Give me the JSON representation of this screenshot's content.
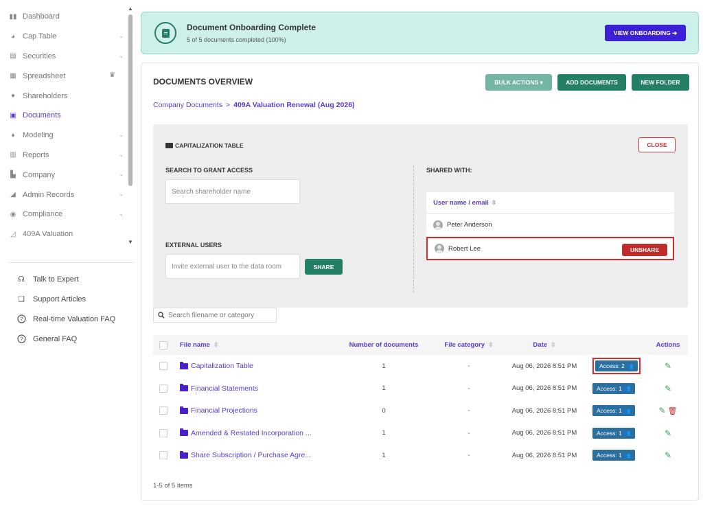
{
  "sidebar": {
    "nav": [
      {
        "label": "Dashboard",
        "icon": "dashboard-icon",
        "glyph": "▮▮",
        "chevron": false
      },
      {
        "label": "Cap Table",
        "icon": "cap-table-icon",
        "glyph": "◕",
        "chevron": true
      },
      {
        "label": "Securities",
        "icon": "securities-icon",
        "glyph": "▤",
        "chevron": true
      },
      {
        "label": "Spreadsheet",
        "icon": "spreadsheet-icon",
        "glyph": "▦",
        "chevron": false,
        "crown": true
      },
      {
        "label": "Shareholders",
        "icon": "shareholders-icon",
        "glyph": "●",
        "chevron": false
      },
      {
        "label": "Documents",
        "icon": "documents-icon",
        "glyph": "▣",
        "chevron": false,
        "active": true
      },
      {
        "label": "Modeling",
        "icon": "modeling-icon",
        "glyph": "♦",
        "chevron": true
      },
      {
        "label": "Reports",
        "icon": "reports-icon",
        "glyph": "▥",
        "chevron": true
      },
      {
        "label": "Company",
        "icon": "company-icon",
        "glyph": "▙",
        "chevron": true
      },
      {
        "label": "Admin Records",
        "icon": "admin-records-icon",
        "glyph": "◢",
        "chevron": true
      },
      {
        "label": "Compliance",
        "icon": "compliance-icon",
        "glyph": "◉",
        "chevron": true
      },
      {
        "label": "409A Valuation",
        "icon": "valuation-icon",
        "glyph": "◿",
        "chevron": false
      }
    ],
    "help": [
      {
        "label": "Talk to Expert",
        "icon": "headset-icon",
        "glyph": "☊"
      },
      {
        "label": "Support Articles",
        "icon": "book-icon",
        "glyph": "❑"
      },
      {
        "label": "Real-time Valuation FAQ",
        "icon": "question-icon",
        "glyph": "?"
      },
      {
        "label": "General FAQ",
        "icon": "question-icon",
        "glyph": "?"
      }
    ]
  },
  "banner": {
    "title": "Document Onboarding Complete",
    "subtitle": "5 of 5 documents completed (100%)",
    "button": "VIEW ONBOARDING ➔"
  },
  "overview": {
    "title": "DOCUMENTS OVERVIEW",
    "bulk_actions": "BULK ACTIONS ▾",
    "add_documents": "ADD DOCUMENTS",
    "new_folder": "NEW FOLDER",
    "breadcrumb_root": "Company Documents",
    "breadcrumb_sep": ">",
    "breadcrumb_current": "409A Valuation Renewal (Aug 2026)"
  },
  "panel": {
    "title": "CAPITALIZATION TABLE",
    "close": "CLOSE",
    "grant_label": "SEARCH TO GRANT ACCESS",
    "grant_placeholder": "Search shareholder name",
    "external_label": "EXTERNAL USERS",
    "external_placeholder": "Invite external user to the data room",
    "share": "SHARE",
    "shared_with_label": "SHARED WITH:",
    "shared_header": "User name / email",
    "shared_users": [
      {
        "name": "Peter Anderson"
      },
      {
        "name": "Robert Lee",
        "unshare": "UNSHARE"
      }
    ]
  },
  "files": {
    "search_placeholder": "Search filename or category",
    "headers": {
      "name": "File name",
      "count": "Number of documents",
      "category": "File category",
      "date": "Date",
      "actions": "Actions"
    },
    "rows": [
      {
        "name": "Capitalization Table",
        "count": "1",
        "category": "-",
        "date": "Aug 06, 2026 8:51 PM",
        "access": "Access: 2",
        "delete": false
      },
      {
        "name": "Financial Statements",
        "count": "1",
        "category": "-",
        "date": "Aug 06, 2026 8:51 PM",
        "access": "Access: 1",
        "delete": false
      },
      {
        "name": "Financial Projections",
        "count": "0",
        "category": "-",
        "date": "Aug 06, 2026 8:51 PM",
        "access": "Access: 1",
        "delete": true
      },
      {
        "name": "Amended & Restated Incorporation ...",
        "count": "1",
        "category": "-",
        "date": "Aug 06, 2026 8:51 PM",
        "access": "Access: 1",
        "delete": false
      },
      {
        "name": "Share Subscription / Purchase Agre...",
        "count": "1",
        "category": "-",
        "date": "Aug 06, 2026 8:51 PM",
        "access": "Access: 1",
        "delete": false
      }
    ],
    "pagination": "1-5 of 5 items"
  },
  "colors": {
    "accent": "#5a3ad3",
    "primary_button": "#238066",
    "danger": "#c02b2b",
    "banner_bg": "#cdf1ea"
  }
}
